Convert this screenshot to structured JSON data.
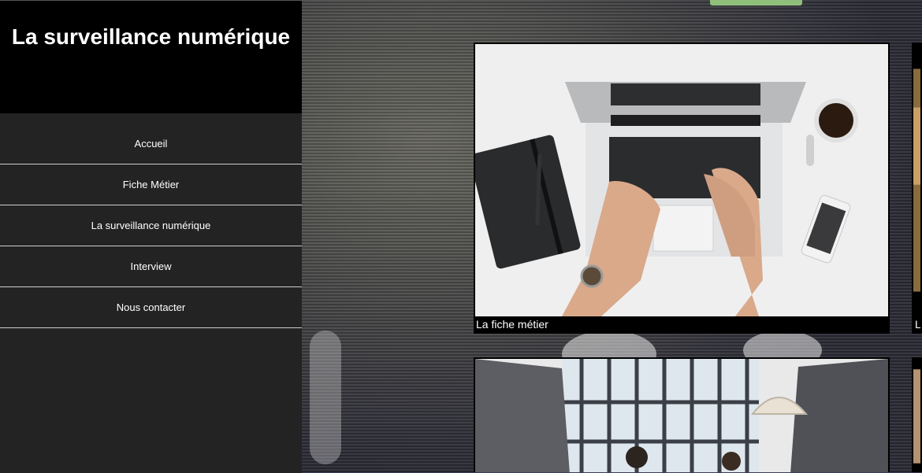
{
  "site": {
    "title": "La surveillance numérique"
  },
  "nav": {
    "items": [
      {
        "label": "Accueil"
      },
      {
        "label": "Fiche Métier"
      },
      {
        "label": "La surveillance numérique"
      },
      {
        "label": "Interview"
      },
      {
        "label": "Nous contacter"
      }
    ]
  },
  "cards": [
    {
      "caption": "La fiche métier"
    },
    {
      "caption": "L"
    }
  ],
  "colors": {
    "sidebar": "#232323",
    "header": "#000000",
    "tab_accent": "#8fbf7a"
  }
}
